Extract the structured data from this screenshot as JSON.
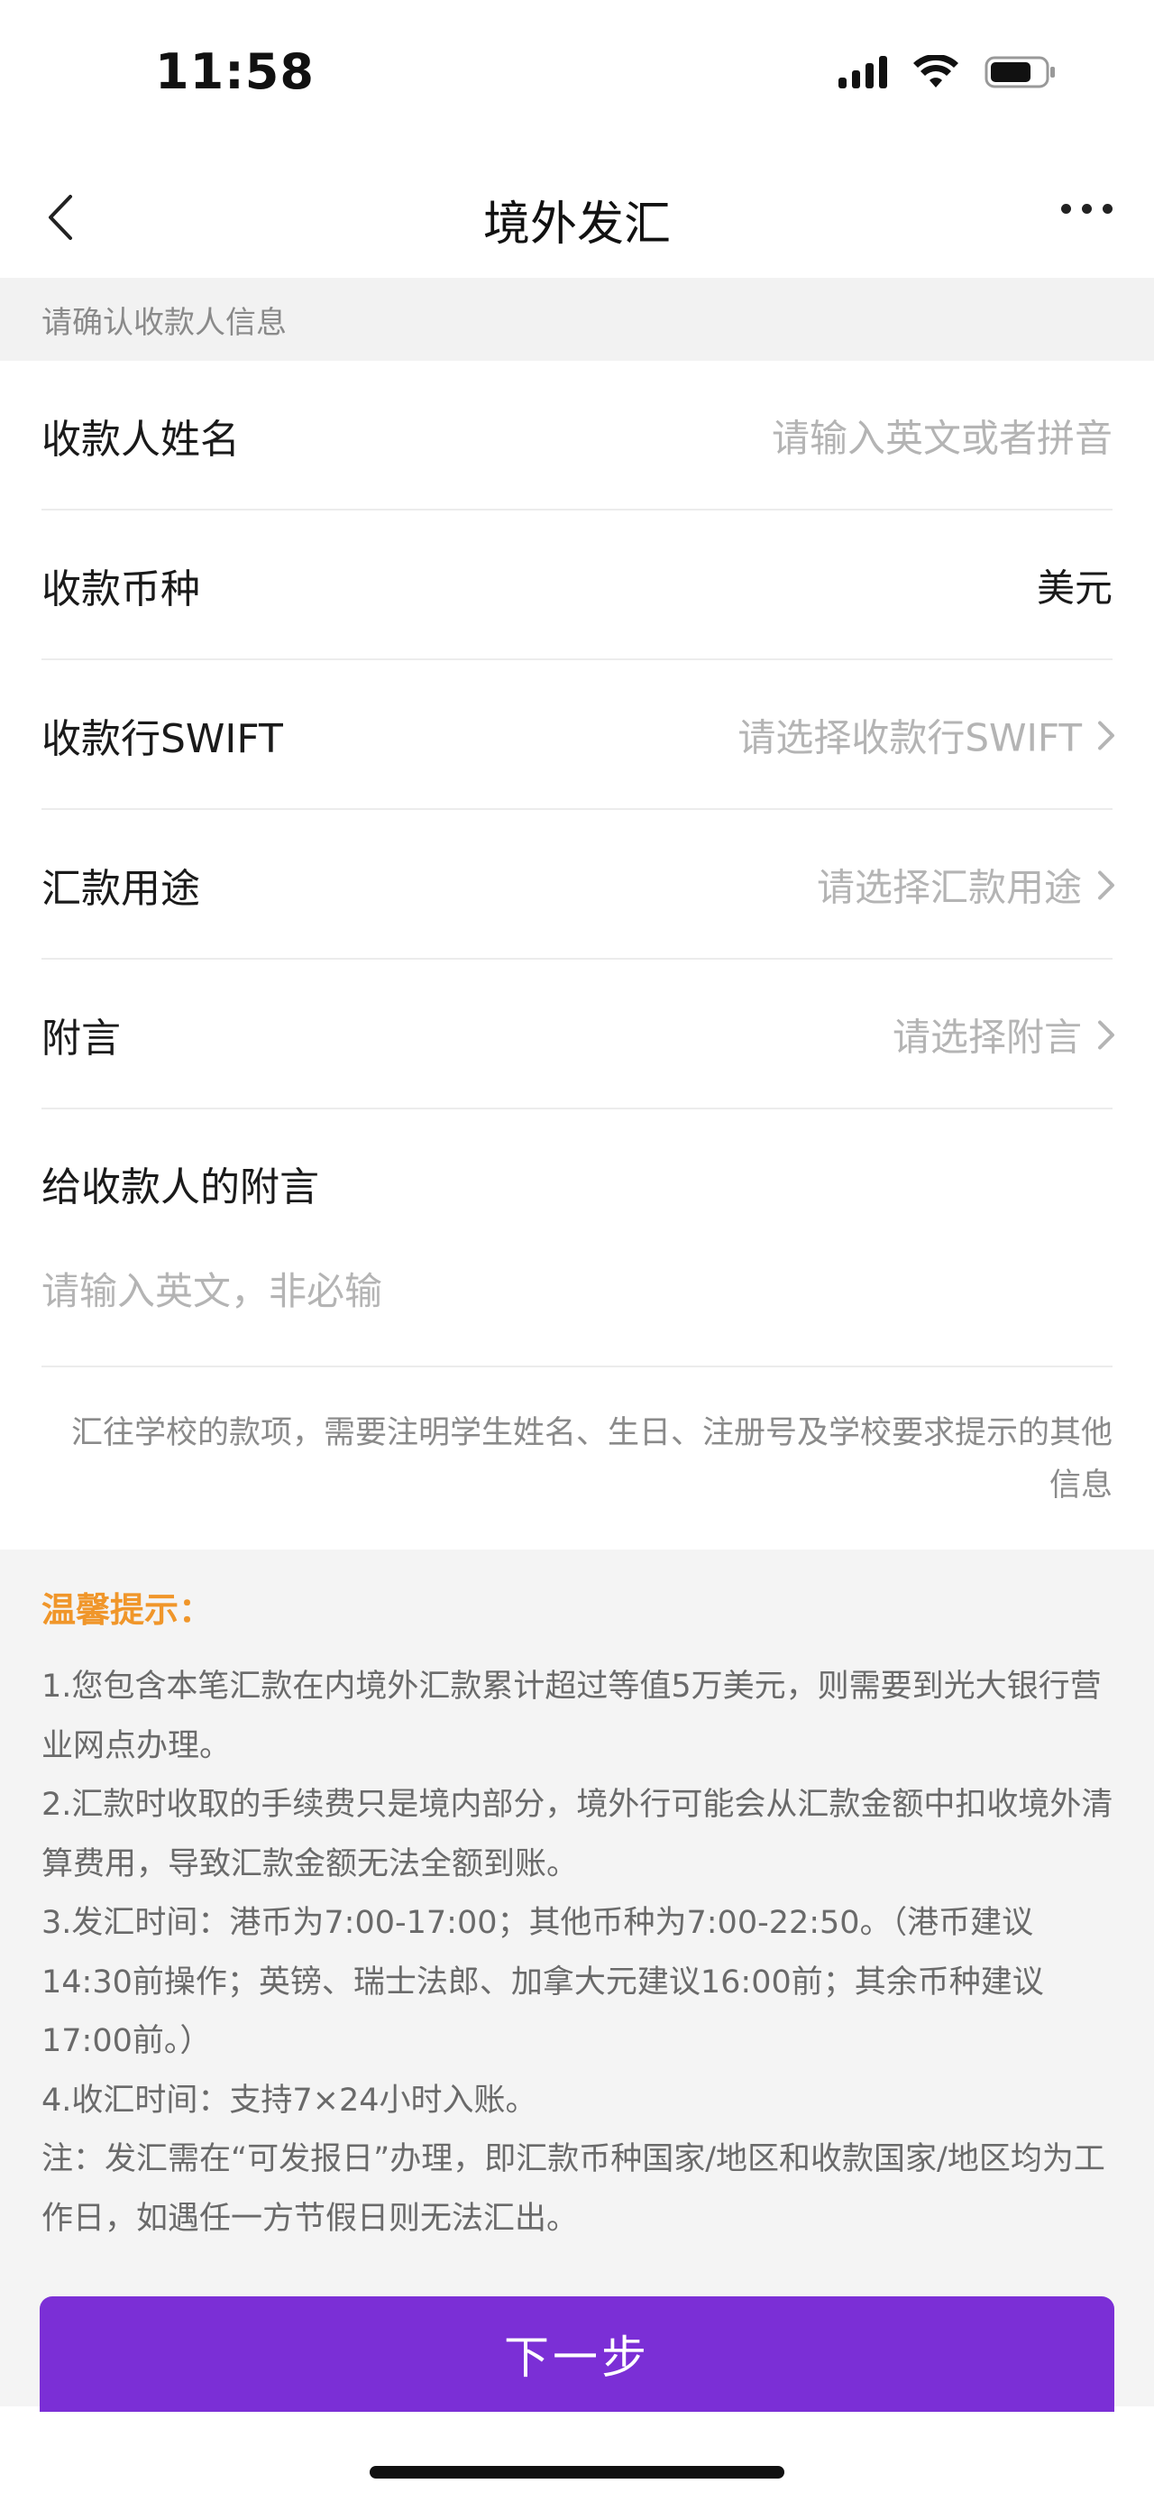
{
  "status_bar": {
    "time": "11:58",
    "icons": [
      "signal-icon",
      "wifi-icon",
      "battery-icon"
    ]
  },
  "nav": {
    "title": "境外发汇",
    "back_icon": "chevron-left-icon",
    "more_icon": "more-horizontal-icon"
  },
  "section_hint": "请确认收款人信息",
  "form": {
    "payee_name": {
      "label": "收款人姓名",
      "placeholder": "请输入英文或者拼音"
    },
    "currency": {
      "label": "收款币种",
      "value": "美元"
    },
    "swift": {
      "label": "收款行SWIFT",
      "placeholder": "请选择收款行SWIFT"
    },
    "purpose": {
      "label": "汇款用途",
      "placeholder": "请选择汇款用途"
    },
    "postscript": {
      "label": "附言",
      "placeholder": "请选择附言"
    },
    "payee_message": {
      "label": "给收款人的附言",
      "placeholder": "请输入英文，非必输"
    }
  },
  "school_note": "汇往学校的款项，需要注明学生姓名、生日、注册号及学校要求提示的其他信息",
  "tips": {
    "title": "温馨提示：",
    "lines": [
      "1.您包含本笔汇款在内境外汇款累计超过等值5万美元，则需要到光大银行营业网点办理。",
      "2.汇款时收取的手续费只是境内部分，境外行可能会从汇款金额中扣收境外清算费用，导致汇款金额无法全额到账。",
      "3.发汇时间：港币为7:00-17:00；其他币种为7:00-22:50。（港币建议14:30前操作；英镑、瑞士法郎、加拿大元建议16:00前；其余币种建议17:00前。）",
      "4.收汇时间：支持7×24小时入账。",
      "注：发汇需在“可发报日”办理，即汇款币种国家/地区和收款国家/地区均为工作日，如遇任一方节假日则无法汇出。"
    ]
  },
  "next_button": "下一步",
  "colors": {
    "accent": "#7b2fd6",
    "tip_title": "#f0962a"
  }
}
